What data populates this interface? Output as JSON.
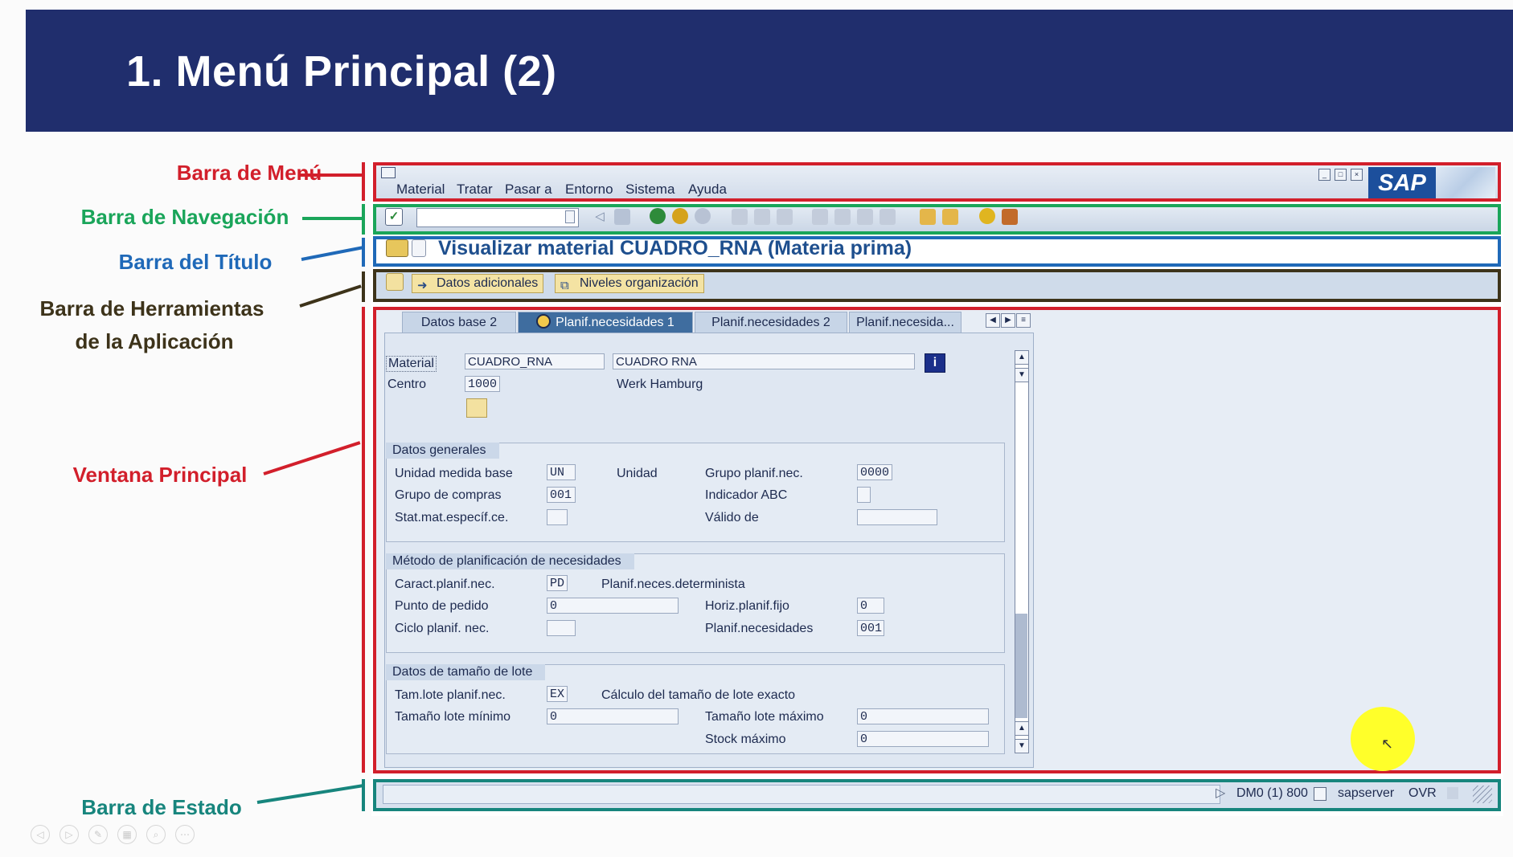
{
  "slide": {
    "title": "1. Menú Principal (2)"
  },
  "labels": {
    "menu_bar": "Barra de Menú",
    "navigation_bar": "Barra de Navegación",
    "title_bar": "Barra del Título",
    "app_toolbar_line1": "Barra de Herramientas",
    "app_toolbar_line2": "de la Aplicación",
    "main_window": "Ventana Principal",
    "status_bar": "Barra de Estado"
  },
  "colors": {
    "header_bg": "#202e6d",
    "menu_bar_label": "#d21f2b",
    "navigation_label": "#1aa55a",
    "title_label": "#1f69b8",
    "app_toolbar_label": "#3d331a",
    "status_label": "#17857d"
  },
  "sap": {
    "logo": "SAP",
    "menu": [
      "Material",
      "Tratar",
      "Pasar a",
      "Entorno",
      "Sistema",
      "Ayuda"
    ],
    "title": "Visualizar material CUADRO_RNA (Materia prima)",
    "app_buttons": [
      "Datos adicionales",
      "Niveles organización"
    ],
    "tabs": [
      "Datos base 2",
      "Planif.necesidades 1",
      "Planif.necesidades 2",
      "Planif.necesida..."
    ],
    "header_fields": {
      "material_label": "Material",
      "material_value": "CUADRO_RNA",
      "material_desc": "CUADRO RNA",
      "centro_label": "Centro",
      "centro_value": "1000",
      "centro_desc": "Werk Hamburg"
    },
    "datos_generales": {
      "title": "Datos generales",
      "unidad_medida_label": "Unidad medida base",
      "unidad_medida_value": "UN",
      "unidad_text": "Unidad",
      "grupo_planif_label": "Grupo planif.nec.",
      "grupo_planif_value": "0000",
      "grupo_compras_label": "Grupo de compras",
      "grupo_compras_value": "001",
      "indicador_abc_label": "Indicador ABC",
      "indicador_abc_value": "",
      "stat_mat_label": "Stat.mat.específ.ce.",
      "stat_mat_value": "",
      "valido_de_label": "Válido de",
      "valido_de_value": ""
    },
    "metodo": {
      "title": "Método de planificación de necesidades",
      "caract_label": "Caract.planif.nec.",
      "caract_value": "PD",
      "caract_desc": "Planif.neces.determinista",
      "punto_pedido_label": "Punto de pedido",
      "punto_pedido_value": "0",
      "horiz_label": "Horiz.planif.fijo",
      "horiz_value": "0",
      "ciclo_label": "Ciclo planif. nec.",
      "ciclo_value": "",
      "planif_label": "Planif.necesidades",
      "planif_value": "001"
    },
    "lote": {
      "title": "Datos de tamaño de lote",
      "tam_lote_label": "Tam.lote planif.nec.",
      "tam_lote_value": "EX",
      "tam_lote_desc": "Cálculo del tamaño de lote exacto",
      "minimo_label": "Tamaño lote mínimo",
      "minimo_value": "0",
      "maximo_label": "Tamaño lote máximo",
      "maximo_value": "0",
      "stock_label": "Stock máximo",
      "stock_value": "0"
    },
    "status": {
      "system": "DM0 (1) 800",
      "server": "sapserver",
      "mode": "OVR"
    }
  }
}
